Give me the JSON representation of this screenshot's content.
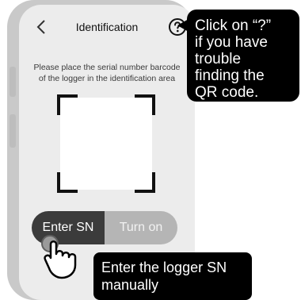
{
  "header": {
    "title": "Identification"
  },
  "instruction": {
    "line1": "Please place the serial number barcode",
    "line2": "of the logger in the identification area"
  },
  "mode_toggle": {
    "enter_sn_label": "Enter SN",
    "turn_on_label": "Turn on",
    "selected": "Enter SN"
  },
  "callouts": {
    "help_text": "Click on “?”\nif you have\ntrouble\nfinding the\nQR code.",
    "enter_sn_text": "Enter the logger SN\nmanually"
  },
  "icons": {
    "back": "chevron-left-icon",
    "help": "question-circle-icon",
    "cursor": "hand-pointer-icon"
  },
  "colors": {
    "active_toggle": "#3b3b3b",
    "inactive_toggle": "#b5b5b5",
    "callout_bg": "#000000",
    "screen_bg": "#ececec"
  }
}
